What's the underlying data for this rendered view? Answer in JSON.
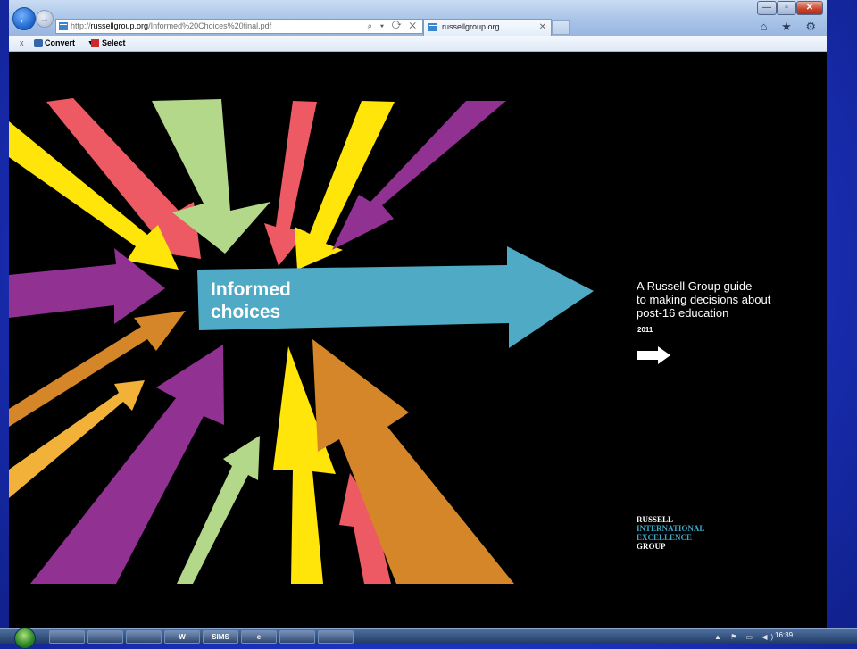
{
  "browser": {
    "address": {
      "prefix": "http://",
      "host": "russellgroup.org",
      "path": "/Informed%20Choices%20final.pdf",
      "tools": "⌕ ▾ ⟳ ✕"
    },
    "tab": {
      "label": "russellgroup.org",
      "close": "✕"
    },
    "window_controls": {
      "minimize": "—",
      "maximize": "▫",
      "close": "✕"
    },
    "right_icons": "⌂ ★ ⚙"
  },
  "command_bar": {
    "close": "x",
    "convert_label": "Convert",
    "caret": "▼",
    "select_label": "Select"
  },
  "cover": {
    "title_line1": "Informed",
    "title_line2": "choices",
    "tagline": [
      "A Russell Group guide",
      "to making decisions about",
      "post-16 education"
    ],
    "year": "2011",
    "logo": [
      "RUSSELL",
      "INTERNATIONAL",
      "EXCELLENCE",
      "GROUP"
    ],
    "colors": {
      "pink": "#ee5a64",
      "green": "#b3d88a",
      "yellow": "#ffe50a",
      "purple": "#913191",
      "orange": "#d58628",
      "blue": "#4faac6",
      "light_orange": "#f2b23a"
    }
  },
  "taskbar": {
    "buttons": [
      "",
      "",
      "",
      "W",
      "SIMS",
      "e",
      "",
      ""
    ],
    "clock": "16:39",
    "tray": "▲ ⚑ ▭ ◀)"
  }
}
